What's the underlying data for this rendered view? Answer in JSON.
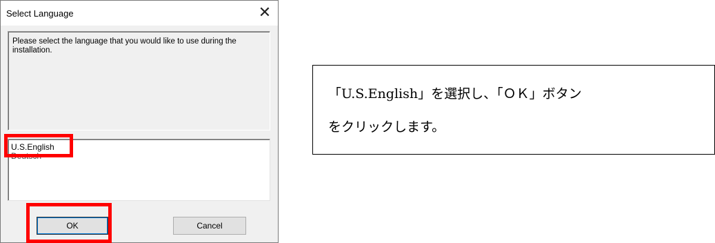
{
  "dialog": {
    "title": "Select Language",
    "close_glyph": "✕",
    "message": "Please select the language that you would like to use during the installation.",
    "languages": [
      "U.S.English",
      "Deutsch"
    ],
    "selected_language": "U.S.English",
    "ok_label": "OK",
    "cancel_label": "Cancel"
  },
  "instruction": {
    "line1": "「U.S.English」を選択し、「ＯＫ」ボタン",
    "line2": "をクリックします。"
  },
  "colors": {
    "highlight": "#ff0000",
    "dialog_bg": "#f0f0f0"
  }
}
